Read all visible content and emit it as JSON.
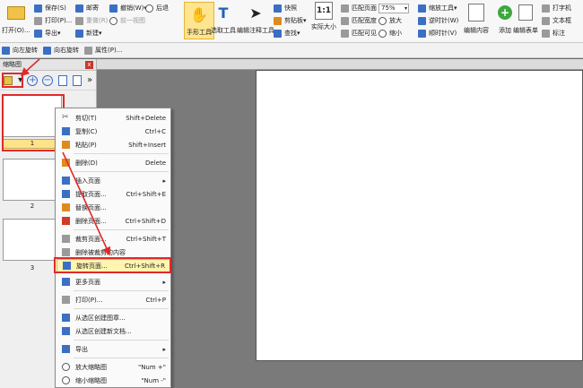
{
  "ribbon": {
    "open_label": "打开(O)...",
    "col1": [
      "保存(S)",
      "打印(P)...",
      "导出"
    ],
    "col2": [
      "邮寄",
      "重做(R)",
      "新建"
    ],
    "col3": [
      "撤销(W)",
      "前一视图"
    ],
    "col4": [
      "后退"
    ],
    "hand_tool": "手形工具",
    "select_text": "选取工具",
    "edit_note": "编辑注释工具",
    "col5": [
      "快照",
      "剪贴板",
      "查找"
    ],
    "actual_size": "实际大小",
    "fit": [
      "匹配页面",
      "匹配宽度",
      "匹配可见"
    ],
    "zoom_value": "75%",
    "zoom_col": [
      "放大",
      "缩小"
    ],
    "zoom_tool": "缩放工具",
    "rotate": [
      "逆时针(W)",
      "顺时针(V)"
    ],
    "edit_content": "编辑内容",
    "add": "添加",
    "edit_form": "编辑表单",
    "typewriter": [
      "打字机",
      "文本框",
      "标注"
    ]
  },
  "toolbar2": [
    "向左旋转",
    "向右旋转",
    "属性(P)..."
  ],
  "panel": {
    "title": "缩略图",
    "close": "x",
    "pages": [
      "1",
      "2",
      "3"
    ]
  },
  "menu": {
    "items": [
      {
        "label": "剪切(T)",
        "shortcut": "Shift+Delete",
        "icon": "scissors-icon"
      },
      {
        "label": "复制(C)",
        "shortcut": "Ctrl+C",
        "icon": "copy-icon"
      },
      {
        "label": "粘贴(P)",
        "shortcut": "Shift+Insert",
        "icon": "paste-icon"
      },
      {
        "label": "删除(D)",
        "shortcut": "Delete",
        "icon": "delete-icon"
      },
      {
        "label": "插入页面",
        "shortcut": "▸",
        "icon": "insert-page-icon"
      },
      {
        "label": "提取页面...",
        "shortcut": "Ctrl+Shift+E",
        "icon": "extract-page-icon"
      },
      {
        "label": "替换页面...",
        "shortcut": "",
        "icon": "replace-page-icon"
      },
      {
        "label": "删除页面...",
        "shortcut": "Ctrl+Shift+D",
        "icon": "delete-page-icon"
      },
      {
        "label": "裁剪页面...",
        "shortcut": "Ctrl+Shift+T",
        "icon": "crop-page-icon"
      },
      {
        "label": "删除被裁剪的内容",
        "shortcut": "",
        "icon": "remove-cropped-icon"
      },
      {
        "label": "旋转页面...",
        "shortcut": "Ctrl+Shift+R",
        "icon": "rotate-page-icon"
      },
      {
        "label": "更多页面",
        "shortcut": "▸",
        "icon": "more-pages-icon"
      },
      {
        "label": "打印(P)...",
        "shortcut": "Ctrl+P",
        "icon": "print-icon"
      },
      {
        "label": "从选区创建图章...",
        "shortcut": "",
        "icon": "stamp-icon"
      },
      {
        "label": "从选区创建新文档...",
        "shortcut": "",
        "icon": "new-doc-icon"
      },
      {
        "label": "导出",
        "shortcut": "▸",
        "icon": "export-icon"
      },
      {
        "label": "放大缩略图",
        "shortcut": "\"Num +\"",
        "icon": "zoom-in-thumb-icon"
      },
      {
        "label": "缩小缩略图",
        "shortcut": "\"Num -\"",
        "icon": "zoom-out-thumb-icon"
      }
    ]
  },
  "colors": {
    "highlight": "#fff4b0",
    "annotation_red": "#e02a2a",
    "doc_background": "#7a7a7a"
  }
}
